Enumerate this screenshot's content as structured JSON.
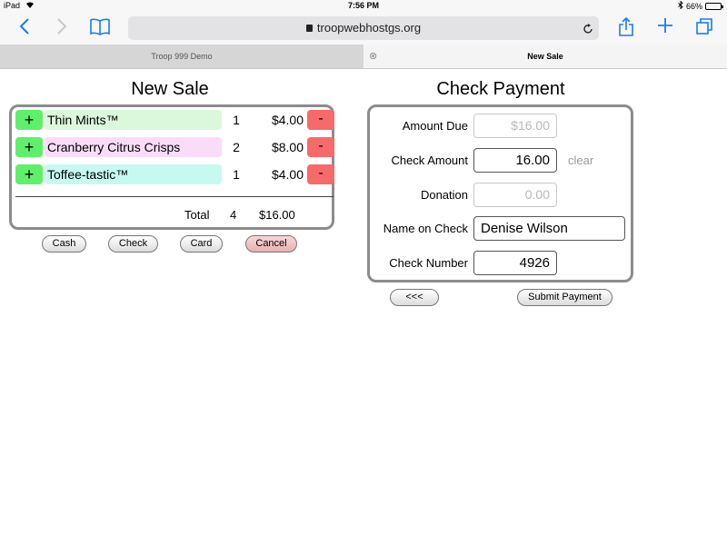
{
  "status_bar": {
    "device": "iPad",
    "time": "7:56 PM",
    "battery_percent": "66%",
    "battery_level": 0.66
  },
  "browser": {
    "url": "troopwebhostgs.org",
    "icons": {
      "back": "chevron-left-icon",
      "forward": "chevron-right-icon",
      "bookmarks": "book-icon",
      "reload": "reload-icon",
      "share": "share-icon",
      "new_tab": "plus-icon",
      "tabs": "tabs-icon"
    }
  },
  "tabs": [
    {
      "label": "Troop 999 Demo",
      "active": false
    },
    {
      "label": "New Sale",
      "active": true
    }
  ],
  "new_sale": {
    "title": "New Sale",
    "items": [
      {
        "plus": "+",
        "name": "Thin Mints™",
        "qty": "1",
        "price": "$4.00",
        "minus": "-",
        "color": "#dcf8dc"
      },
      {
        "plus": "+",
        "name": "Cranberry Citrus Crisps",
        "qty": "2",
        "price": "$8.00",
        "minus": "-",
        "color": "#fadcf8"
      },
      {
        "plus": "+",
        "name": "Toffee-tastic™",
        "qty": "1",
        "price": "$4.00",
        "minus": "-",
        "color": "#c6faf0"
      }
    ],
    "total_label": "Total",
    "total_qty": "4",
    "total_price": "$16.00",
    "buttons": {
      "cash": "Cash",
      "check": "Check",
      "card": "Card",
      "cancel": "Cancel"
    }
  },
  "check_payment": {
    "title": "Check Payment",
    "amount_due_label": "Amount Due",
    "amount_due_value": "$16.00",
    "check_amount_label": "Check Amount",
    "check_amount_value": "16.00",
    "clear_label": "clear",
    "donation_label": "Donation",
    "donation_value": "0.00",
    "name_label": "Name on Check",
    "name_value": "Denise Wilson",
    "number_label": "Check Number",
    "number_value": "4926",
    "back_button": "<<<",
    "submit_button": "Submit Payment"
  },
  "colors": {
    "accent": "#1a7cf4",
    "plus_button": "#5ef06a",
    "minus_button": "#f76a6a",
    "panel_border": "#8c8c8c"
  }
}
